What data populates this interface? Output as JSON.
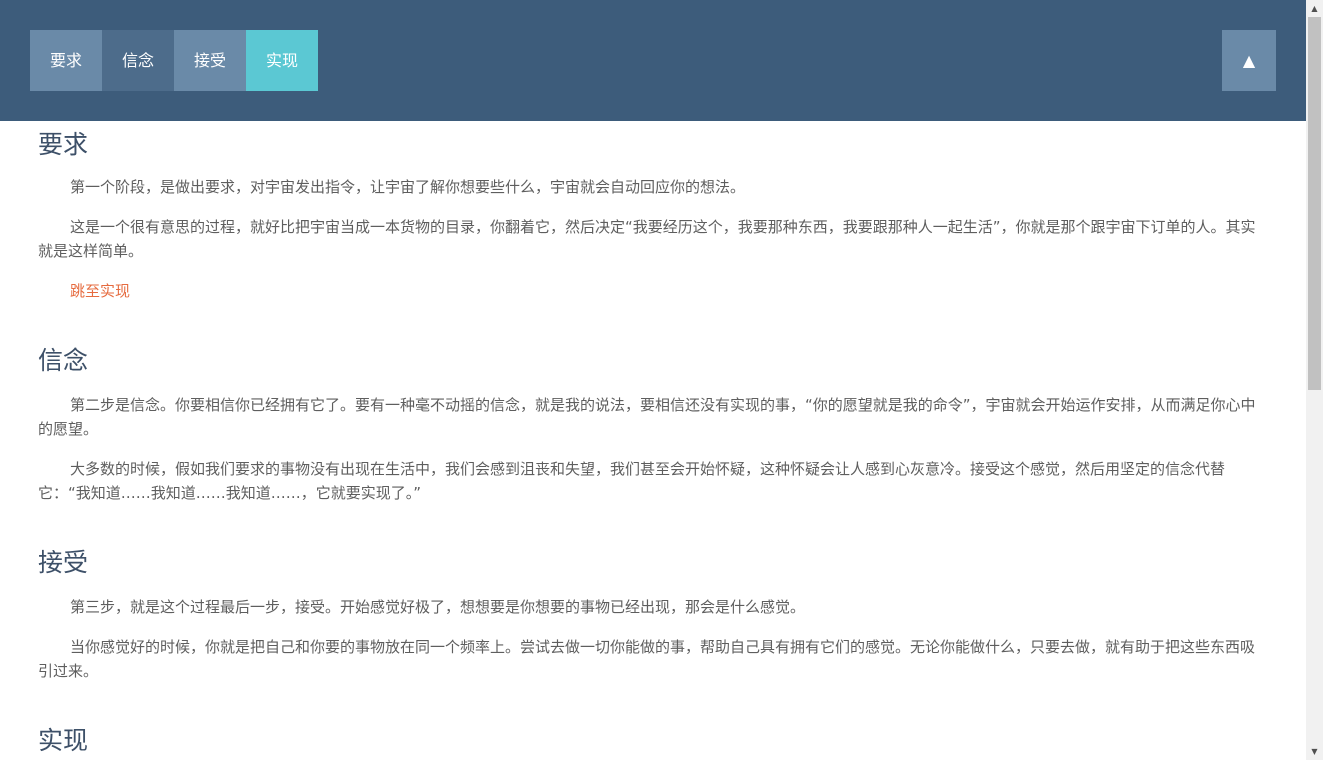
{
  "nav": {
    "tabs": [
      {
        "label": "要求"
      },
      {
        "label": "信念"
      },
      {
        "label": "接受"
      },
      {
        "label": "实现"
      }
    ],
    "top_button": "▲"
  },
  "sections": [
    {
      "title": "要求",
      "paragraphs": [
        "第一个阶段，是做出要求，对宇宙发出指令，让宇宙了解你想要些什么，宇宙就会自动回应你的想法。",
        "这是一个很有意思的过程，就好比把宇宙当成一本货物的目录，你翻着它，然后决定“我要经历这个，我要那种东西，我要跟那种人一起生活”，你就是那个跟宇宙下订单的人。其实就是这样简单。"
      ],
      "link": "跳至实现"
    },
    {
      "title": "信念",
      "paragraphs": [
        "第二步是信念。你要相信你已经拥有它了。要有一种毫不动摇的信念，就是我的说法，要相信还没有实现的事，“你的愿望就是我的命令”，宇宙就会开始运作安排，从而满足你心中的愿望。",
        "大多数的时候，假如我们要求的事物没有出现在生活中，我们会感到沮丧和失望，我们甚至会开始怀疑，这种怀疑会让人感到心灰意冷。接受这个感觉，然后用坚定的信念代替它：“我知道……我知道……我知道……，它就要实现了。”"
      ]
    },
    {
      "title": "接受",
      "paragraphs": [
        "第三步，就是这个过程最后一步，接受。开始感觉好极了，想想要是你想要的事物已经出现，那会是什么感觉。",
        "当你感觉好的时候，你就是把自己和你要的事物放在同一个频率上。尝试去做一切你能做的事，帮助自己具有拥有它们的感觉。无论你能做什么，只要去做，就有助于把这些东西吸引过来。"
      ]
    },
    {
      "title": "实现"
    }
  ],
  "colors": {
    "header_bg": "#3d5c7b",
    "tab_default": "#6a8aa8",
    "tab_hover": "#4d6c8b",
    "tab_active": "#5bc8d3",
    "link": "#e66b3f",
    "heading": "#3d5068",
    "body_text": "#5e5e5e"
  },
  "icons": {
    "top_button": "arrow-up-icon"
  }
}
